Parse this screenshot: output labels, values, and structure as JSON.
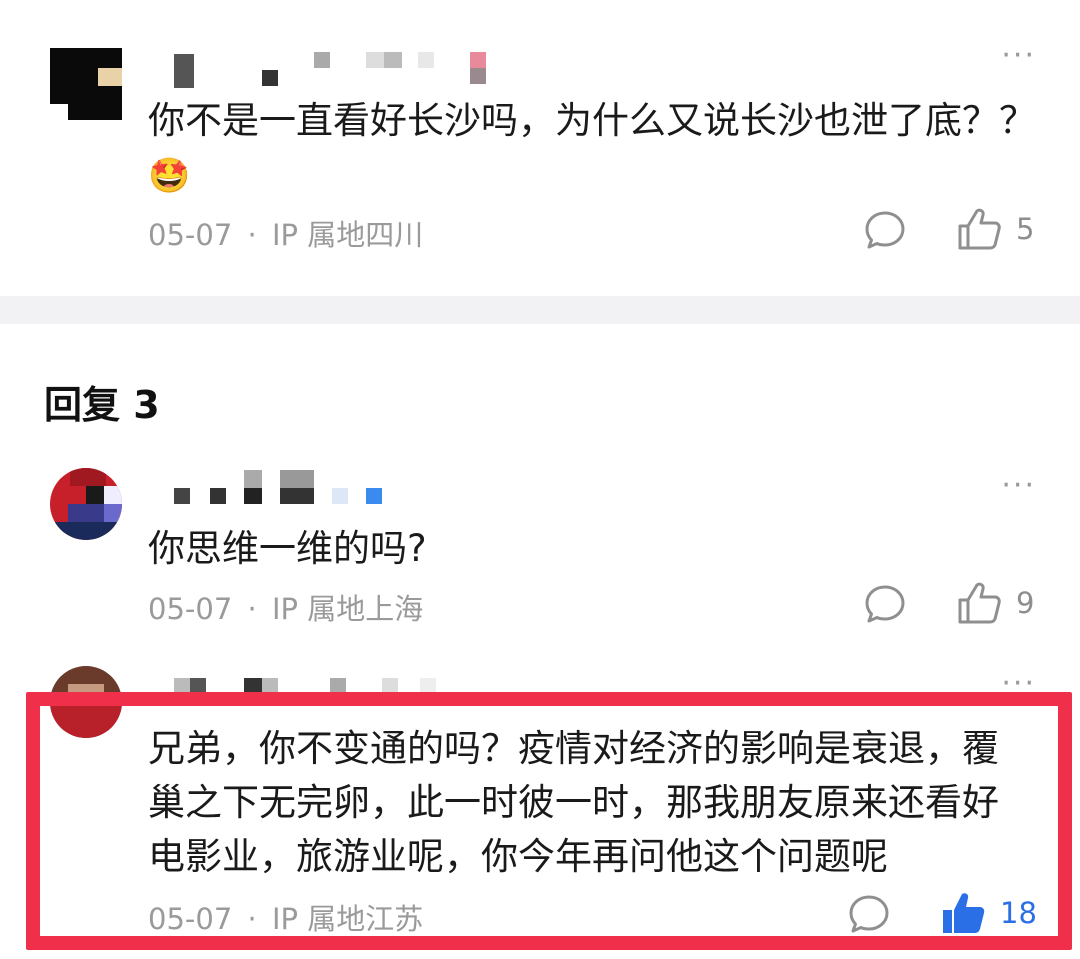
{
  "comments": [
    {
      "text": "你不是一直看好长沙吗，为什么又说长沙也泄了底？？",
      "emoji": "🤩",
      "date": "05-07",
      "separator": "·",
      "ip": "IP 属地四川",
      "likes": "5",
      "liked": false
    },
    {
      "text": "你思维一维的吗?",
      "date": "05-07",
      "separator": "·",
      "ip": "IP 属地上海",
      "likes": "9",
      "liked": false
    },
    {
      "text": "兄弟，你不变通的吗？疫情对经济的影响是衰退，覆巢之下无完卵，此一时彼一时，那我朋友原来还看好电影业，旅游业呢，你今年再问他这个问题呢",
      "date": "05-07",
      "separator": "·",
      "ip": "IP 属地江苏",
      "likes": "18",
      "liked": true
    }
  ],
  "replies_header": "回复 3",
  "more_label": "···",
  "colors": {
    "like_active": "#2b6fe6",
    "highlight_border": "#f0304a",
    "meta_text": "#9a9a9a"
  },
  "icons": {
    "reply": "speech-bubble-icon",
    "like": "thumbs-up-icon",
    "more": "more-dots-icon"
  }
}
